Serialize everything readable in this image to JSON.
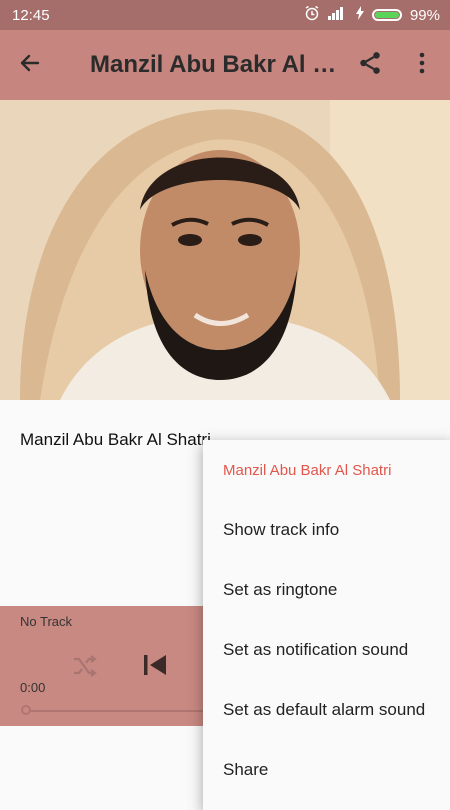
{
  "status_bar": {
    "time": "12:45",
    "battery": "99%"
  },
  "app_bar": {
    "title": "Manzil Abu Bakr Al Shatri"
  },
  "track_title": "Manzil Abu Bakr Al Shatri",
  "player": {
    "now_playing": "No Track",
    "elapsed": "0:00",
    "progress_fraction": 0
  },
  "menu": {
    "header": "Manzil Abu Bakr Al Shatri",
    "items": [
      "Show track info",
      "Set as ringtone",
      "Set as notification sound",
      "Set as default alarm sound",
      "Share"
    ]
  },
  "colors": {
    "status_bar": "#a66e6a",
    "app_bar": "#c6857e",
    "player": "#c98983",
    "menu_header": "#e2574c"
  },
  "icons": [
    "back-arrow-icon",
    "share-icon",
    "more-vert-icon",
    "alarm-icon",
    "signal-icon",
    "charging-icon",
    "battery-icon",
    "shuffle-icon",
    "skip-previous-icon"
  ]
}
